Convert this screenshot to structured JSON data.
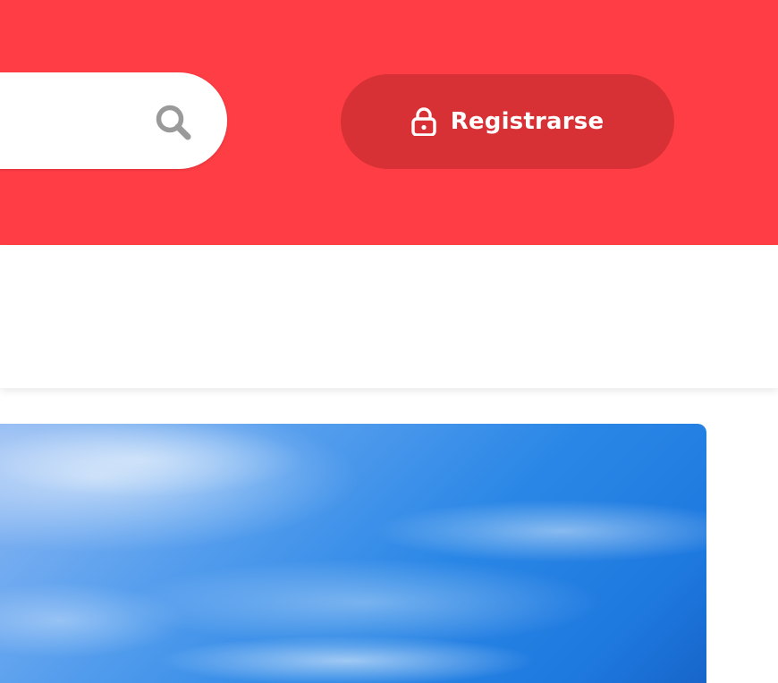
{
  "header": {
    "background_color": "#ff3d44",
    "search": {
      "placeholder": "",
      "icon": "search-icon"
    },
    "register_button": {
      "label": "Registrarse",
      "icon": "lock-icon",
      "background_color": "#d73035"
    }
  },
  "nav": {
    "background_color": "#ffffff"
  },
  "hero": {
    "image": "blue-sky-with-clouds"
  }
}
